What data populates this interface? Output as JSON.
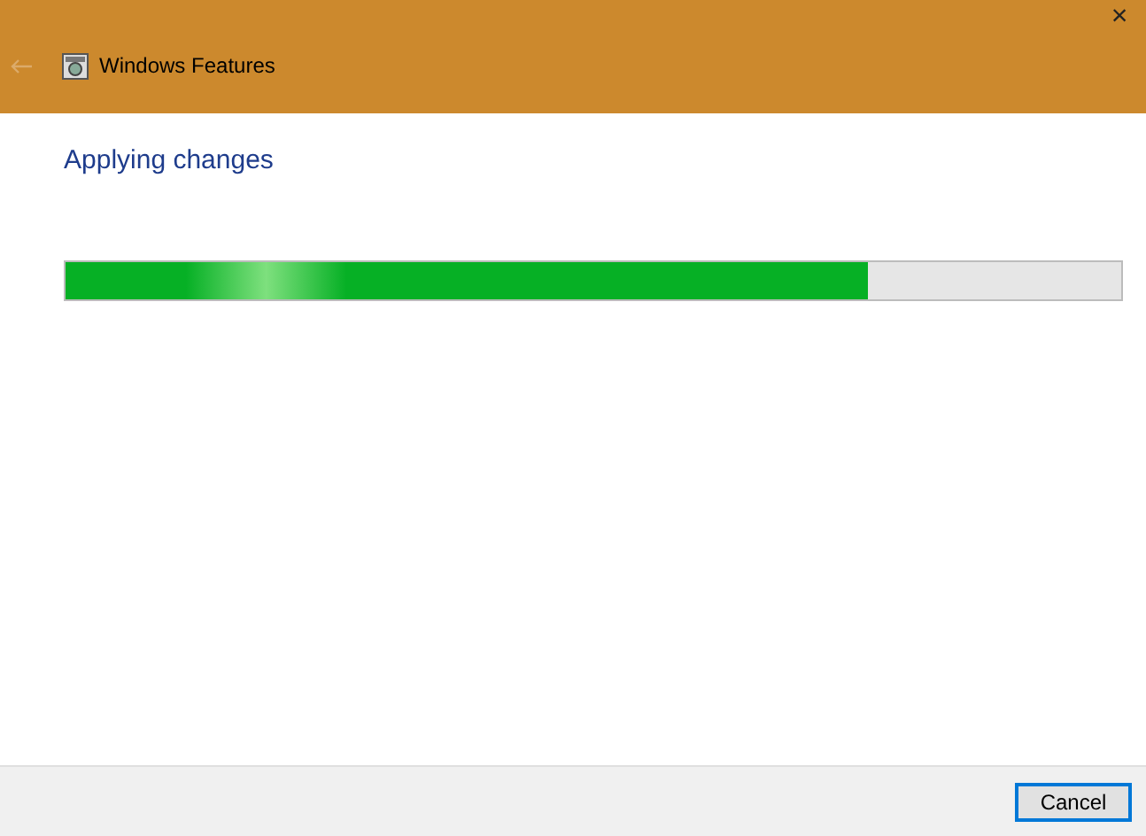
{
  "window": {
    "title": "Windows Features",
    "close": "×"
  },
  "heading": "Applying changes",
  "progress": {
    "level": 0.76
  },
  "buttons": [
    {
      "label": "Cancel",
      "selected": true
    }
  ]
}
